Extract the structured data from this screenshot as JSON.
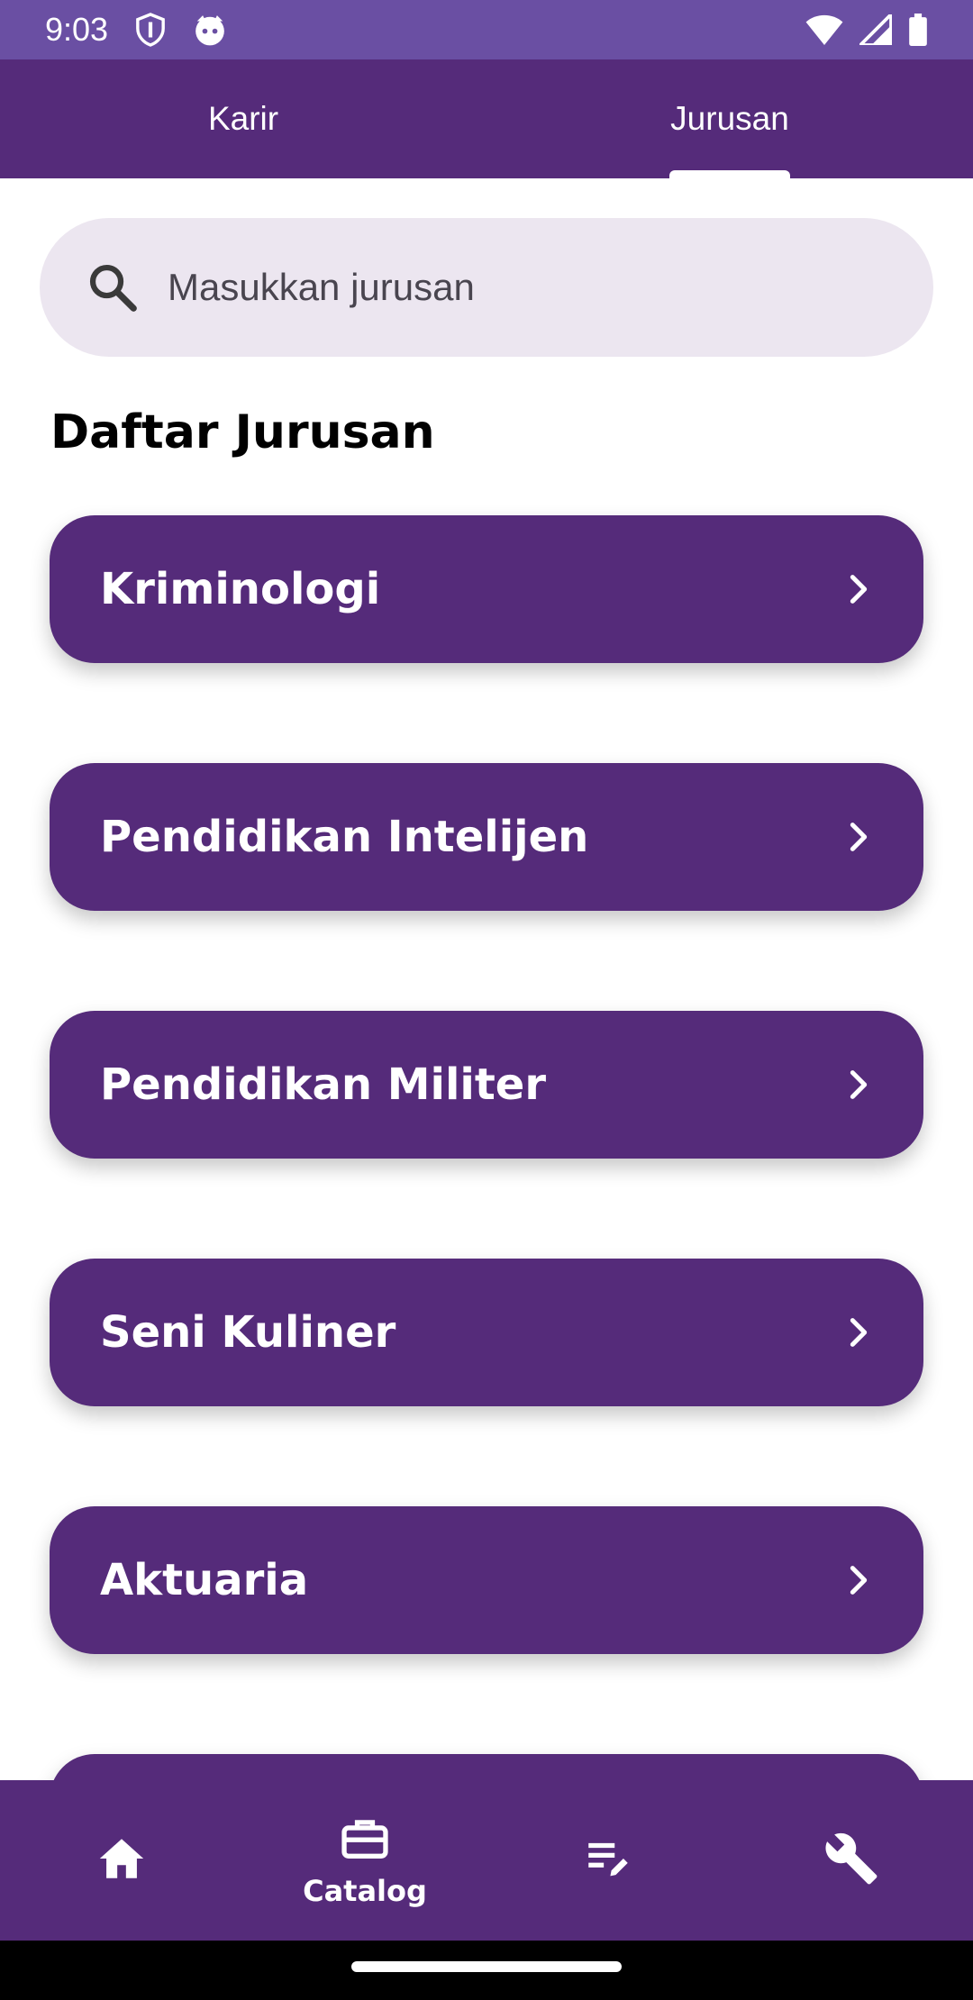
{
  "status_bar": {
    "time": "9:03",
    "icons": [
      "shield-icon",
      "cat-icon",
      "wifi-icon",
      "signal-icon",
      "battery-icon"
    ]
  },
  "top_tabs": [
    {
      "label": "Karir",
      "selected": false
    },
    {
      "label": "Jurusan",
      "selected": true
    }
  ],
  "search": {
    "placeholder": "Masukkan jurusan",
    "value": ""
  },
  "section_title": "Daftar Jurusan",
  "majors": [
    {
      "label": "Kriminologi"
    },
    {
      "label": "Pendidikan Intelijen"
    },
    {
      "label": "Pendidikan Militer"
    },
    {
      "label": "Seni Kuliner"
    },
    {
      "label": "Aktuaria"
    },
    {
      "label": ""
    }
  ],
  "bottom_nav": [
    {
      "icon": "home-icon",
      "label": "",
      "selected": false
    },
    {
      "icon": "briefcase-icon",
      "label": "Catalog",
      "selected": true
    },
    {
      "icon": "edit-list-icon",
      "label": "",
      "selected": false
    },
    {
      "icon": "wrench-icon",
      "label": "",
      "selected": false
    }
  ],
  "colors": {
    "status_bar": "#6a4fa3",
    "primary": "#552b7a",
    "search_bg": "#ece6f0",
    "on_primary": "#ffffff"
  }
}
